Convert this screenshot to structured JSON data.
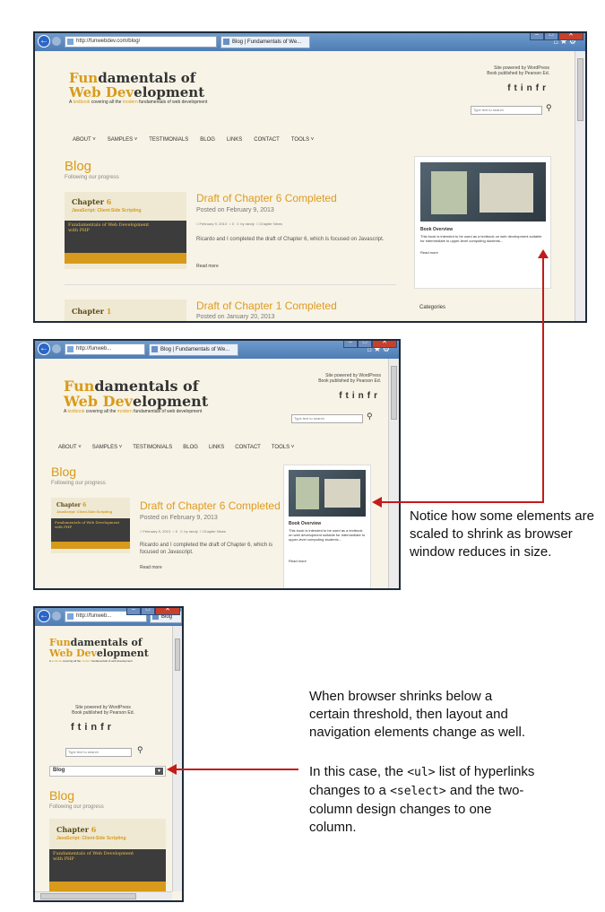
{
  "browser": {
    "url_full": "http://funwebdev.com/blog/",
    "url_short": "http://funweb...",
    "tab_full": "Blog | Fundamentals of We...",
    "tab_mid": "Blog | Fundamentals of We...",
    "tab_small": "Blog",
    "addr_icons": "⌕ ▾ ⊠ ↻ ✕"
  },
  "site": {
    "logo_line1_hl": "Fun",
    "logo_line1_rest": "damentals of",
    "logo_line2_hl": "Web Dev",
    "logo_line2_rest": "elopment",
    "tagline_a": "A",
    "tagline_b": "textbook",
    "tagline_c": "covering all the",
    "tagline_d": "modern",
    "tagline_e": "fundamentals of web development",
    "powered_1": "Site powered by WordPress",
    "powered_2": "Book published by Pearson Ed.",
    "social_f": "f",
    "social_t": "t",
    "social_in": "in",
    "social_fr": "fr",
    "search_placeholder": "Type text to search",
    "nav": [
      "ABOUT ˅",
      "SAMPLES ˅",
      "TESTIMONIALS",
      "BLOG",
      "LINKS",
      "CONTACT",
      "TOOLS ˅"
    ],
    "select_value": "Blog"
  },
  "blog": {
    "heading": "Blog",
    "subheading": "Following our progress",
    "chapter_label": "Chapter",
    "chapter_6": "6",
    "chapter_1": "1",
    "card_js": "JavaScript: Client-Side Scripting",
    "card_dark_1": "Fundamentals of Web Development",
    "card_dark_2": "with PHP",
    "post1_title": "Draft of Chapter 6 Completed",
    "post1_date": "Posted on February 9, 2013",
    "post1_meta": "February 9, 2013",
    "post1_meta2": "0",
    "post1_meta3": "by randy",
    "post1_meta4": "Chapter News",
    "post1_excerpt": "Ricardo and I completed the draft of Chapter 6, which is focused on Javascript.",
    "read_more": "Read more",
    "post2_title": "Draft of Chapter 1 Completed",
    "post2_date": "Posted on January 20, 2013"
  },
  "sidebar": {
    "book_title": "Book Overview",
    "book_text_full": "This book is intended to be used as a textbook on web development suitable for intermediate to upper-level computing students...",
    "book_text_mid": "This book is intended to be used as a textbook on web development suitable for intermediate to upper-level computing students...",
    "read_more": "Read more",
    "categories": "Categories"
  },
  "annotations": {
    "note1": "Notice how some elements are scaled to shrink as browser window reduces in size.",
    "note2": "When browser shrinks below a certain threshold, then layout and navigation elements change as well.",
    "note3_a": "In this case, the ",
    "note3_ul": "<ul>",
    "note3_b": " list of hyperlinks changes to a ",
    "note3_select": "<select>",
    "note3_c": " and the two-column design changes to one column."
  },
  "colors": {
    "accent": "#d89a1a",
    "arrow": "#c41a1a"
  }
}
